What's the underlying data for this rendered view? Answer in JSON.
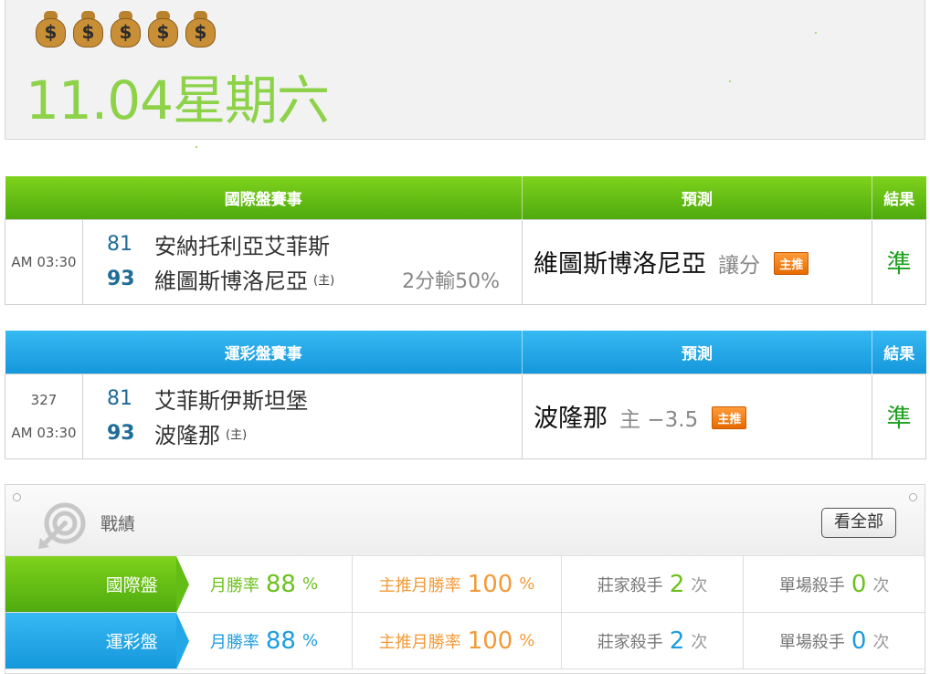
{
  "header": {
    "icons": [
      "money-bag",
      "money-bag",
      "money-bag",
      "money-bag",
      "money-bag"
    ],
    "money_sign": "$",
    "date": "11.04星期六"
  },
  "international": {
    "headers": {
      "match": "國際盤賽事",
      "prediction": "預測",
      "result": "結果"
    },
    "row": {
      "time": "AM 03:30",
      "away_score": "81",
      "away_team": "安納托利亞艾菲斯",
      "home_score": "93",
      "home_team": "維圖斯博洛尼亞",
      "home_mark": "(主)",
      "odds_note": "2分輸50%",
      "prediction_team": "維圖斯博洛尼亞",
      "prediction_type": "讓分",
      "badge": "主推",
      "result": "準"
    }
  },
  "sports_lottery": {
    "headers": {
      "match": "運彩盤賽事",
      "prediction": "預測",
      "result": "結果"
    },
    "row": {
      "code": "327",
      "time": "AM 03:30",
      "away_score": "81",
      "away_team": "艾菲斯伊斯坦堡",
      "home_score": "93",
      "home_team": "波隆那",
      "home_mark": "(主)",
      "prediction_team": "波隆那",
      "prediction_type": "主 −3.5",
      "badge": "主推",
      "result": "準"
    }
  },
  "record": {
    "title": "戰績",
    "view_all": "看全部",
    "rows": [
      {
        "label": "國際盤",
        "monthly_label": "月勝率",
        "monthly_value": "88",
        "monthly_unit": "%",
        "main_label": "主推月勝率",
        "main_value": "100",
        "main_unit": "%",
        "dealer_label": "莊家殺手",
        "dealer_value": "2",
        "dealer_unit": "次",
        "single_label": "單場殺手",
        "single_value": "0",
        "single_unit": "次"
      },
      {
        "label": "運彩盤",
        "monthly_label": "月勝率",
        "monthly_value": "88",
        "monthly_unit": "%",
        "main_label": "主推月勝率",
        "main_value": "100",
        "main_unit": "%",
        "dealer_label": "莊家殺手",
        "dealer_value": "2",
        "dealer_unit": "次",
        "single_label": "單場殺手",
        "single_value": "0",
        "single_unit": "次"
      }
    ]
  },
  "colors": {
    "green": "#6cc11e",
    "blue": "#1d9de0",
    "orange": "#f39a38",
    "result_green": "#20a020",
    "date_green": "#8ed24a"
  }
}
